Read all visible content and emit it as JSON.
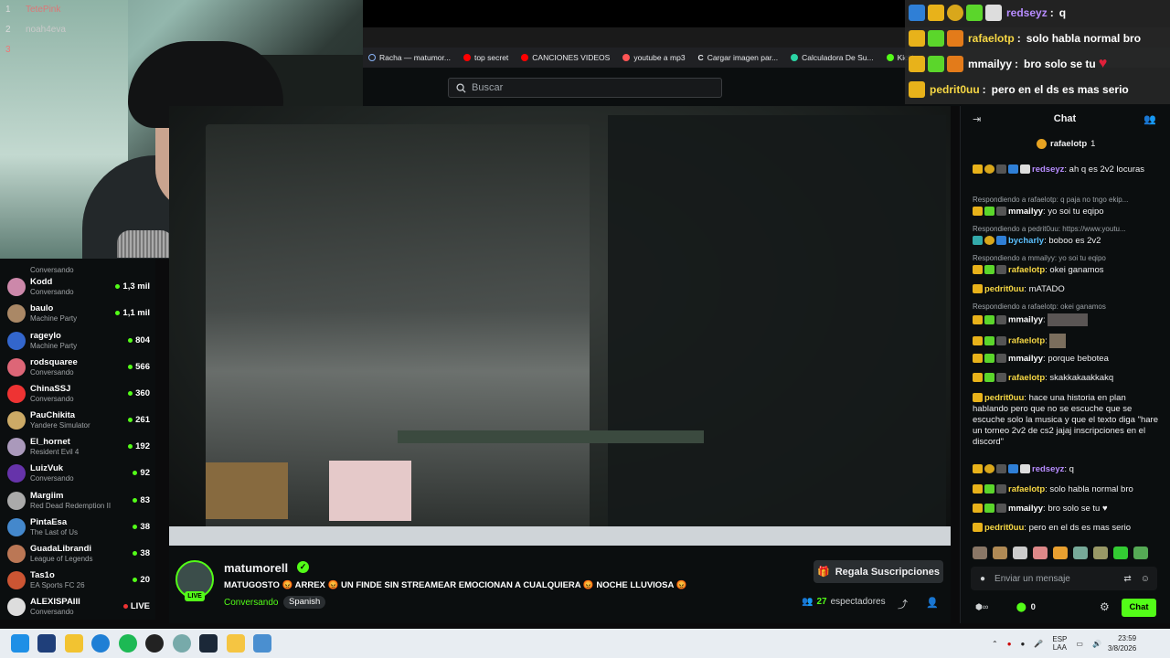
{
  "webcam": {
    "leaderboard": [
      {
        "rank": "1",
        "name": "TetePink"
      },
      {
        "rank": "2",
        "name": "noah4eva"
      },
      {
        "rank": "3",
        "name": ""
      }
    ]
  },
  "browser": {
    "bookmarks": [
      {
        "label": "Racha — matumor...",
        "color": "#8ab4f8"
      },
      {
        "label": "top secret",
        "color": "#ff0000"
      },
      {
        "label": "CANCIONES VIDEOS",
        "color": "#ff0000"
      },
      {
        "label": "youtube a mp3",
        "color": "#ff5050"
      },
      {
        "label": "Cargar imagen par...",
        "color": "#ffffff"
      },
      {
        "label": "Calculadora De Su...",
        "color": "#2bd4a4"
      },
      {
        "label": "Kickle",
        "color": "#53fc18"
      }
    ]
  },
  "kick": {
    "search_placeholder": "Buscar"
  },
  "overlay_chat": [
    {
      "user": "redseyz",
      "user_color": "#b78cff",
      "message": "q"
    },
    {
      "user": "rafaelotp",
      "user_color": "#f6d744",
      "message": "solo habla normal bro"
    },
    {
      "user": "mmailyy",
      "user_color": "#ffffff",
      "message": "bro solo se tu"
    },
    {
      "user": "pedrit0uu",
      "user_color": "#f6d744",
      "message": "pero en el ds es mas serio"
    }
  ],
  "sidebar": {
    "items": [
      {
        "name": "",
        "category": "Conversando",
        "count": "",
        "avatar_color": "#5a6"
      },
      {
        "name": "Kodd",
        "category": "Conversando",
        "count": "1,3 mil",
        "avatar_color": "#c8a"
      },
      {
        "name": "baulo",
        "category": "Machine Party",
        "count": "1,1 mil",
        "avatar_color": "#a86"
      },
      {
        "name": "rageylo",
        "category": "Machine Party",
        "count": "804",
        "avatar_color": "#36c"
      },
      {
        "name": "rodsquaree",
        "category": "Conversando",
        "count": "566",
        "avatar_color": "#d67"
      },
      {
        "name": "ChinaSSJ",
        "category": "Conversando",
        "count": "360",
        "avatar_color": "#e33"
      },
      {
        "name": "PauChikita",
        "category": "Yandere Simulator",
        "count": "261",
        "avatar_color": "#ca6"
      },
      {
        "name": "El_hornet",
        "category": "Resident Evil 4",
        "count": "192",
        "avatar_color": "#a9b"
      },
      {
        "name": "LuizVuk",
        "category": "Conversando",
        "count": "92",
        "avatar_color": "#63a"
      },
      {
        "name": "Margiim",
        "category": "Red Dead Redemption II",
        "count": "83",
        "avatar_color": "#aaa"
      },
      {
        "name": "PintaEsa",
        "category": "The Last of Us",
        "count": "38",
        "avatar_color": "#48c"
      },
      {
        "name": "GuadaLibrandi",
        "category": "League of Legends",
        "count": "38",
        "avatar_color": "#b75"
      },
      {
        "name": "Tas1o",
        "category": "EA Sports FC 26",
        "count": "20",
        "avatar_color": "#c53"
      },
      {
        "name": "ALEXISPAIII",
        "category": "Conversando",
        "count": "LIVE",
        "avatar_color": "#ddd"
      }
    ]
  },
  "stream": {
    "streamer": "matumorell",
    "live_badge": "LIVE",
    "title": "MATUGOSTO 😡 ARREX 😡 UN FINDE SIN STREAMEAR EMOCIONAN A CUALQUIERA 😡 NOCHE LLUVIOSA 😡",
    "category": "Conversando",
    "language": "Spanish",
    "gift_button": "Regala Suscripciones",
    "viewers_count": "27",
    "viewers_label": "espectadores"
  },
  "chat": {
    "title": "Chat",
    "pinned_user": "rafaelotp",
    "pinned_count": "1",
    "messages": [
      {
        "type": "msg",
        "user": "redseyz",
        "color": "#b78cff",
        "text": "ah q es 2v2 locuras"
      },
      {
        "type": "reply",
        "text": "Respondiendo a rafaelotp: q paja no tngo ekip..."
      },
      {
        "type": "msg",
        "user": "mmailyy",
        "color": "#ffffff",
        "text": "yo soi tu eqipo"
      },
      {
        "type": "reply",
        "text": "Respondiendo a pedrit0uu: https://www.youtu..."
      },
      {
        "type": "msg",
        "user": "bycharly",
        "color": "#5bc0ff",
        "text": "boboo es 2v2"
      },
      {
        "type": "reply",
        "text": "Respondiendo a mmailyy: yo soi tu eqipo"
      },
      {
        "type": "msg",
        "user": "rafaelotp",
        "color": "#f6d744",
        "text": "okei ganamos"
      },
      {
        "type": "msg",
        "user": "pedrit0uu",
        "color": "#f6d744",
        "text": "mATADO"
      },
      {
        "type": "reply",
        "text": "Respondiendo a rafaelotp: okei ganamos"
      },
      {
        "type": "msg",
        "user": "mmailyy",
        "color": "#ffffff",
        "text": ""
      },
      {
        "type": "msg",
        "user": "rafaelotp",
        "color": "#f6d744",
        "text": ""
      },
      {
        "type": "msg",
        "user": "mmailyy",
        "color": "#ffffff",
        "text": "porque bebotea"
      },
      {
        "type": "msg",
        "user": "rafaelotp",
        "color": "#f6d744",
        "text": "skakkakaakkakq"
      },
      {
        "type": "msg",
        "user": "pedrit0uu",
        "color": "#f6d744",
        "text": "hace una historia en plan hablando pero que no se escuche que se escuche solo la musica y que el texto diga \"hare un torneo 2v2 de cs2 jajaj inscripciones en el discord\""
      },
      {
        "type": "msg",
        "user": "redseyz",
        "color": "#b78cff",
        "text": "q"
      },
      {
        "type": "msg",
        "user": "rafaelotp",
        "color": "#f6d744",
        "text": "solo habla normal bro"
      },
      {
        "type": "msg",
        "user": "mmailyy",
        "color": "#ffffff",
        "text": "bro solo se tu ♥"
      },
      {
        "type": "msg",
        "user": "pedrit0uu",
        "color": "#f6d744",
        "text": "pero en el ds es mas serio"
      }
    ],
    "input_placeholder": "Enviar un mensaje",
    "points": "0",
    "send_label": "Chat"
  },
  "taskbar": {
    "lang_top": "ESP",
    "lang_bottom": "LAA",
    "time": "23:59",
    "date": "3/8/2026"
  }
}
